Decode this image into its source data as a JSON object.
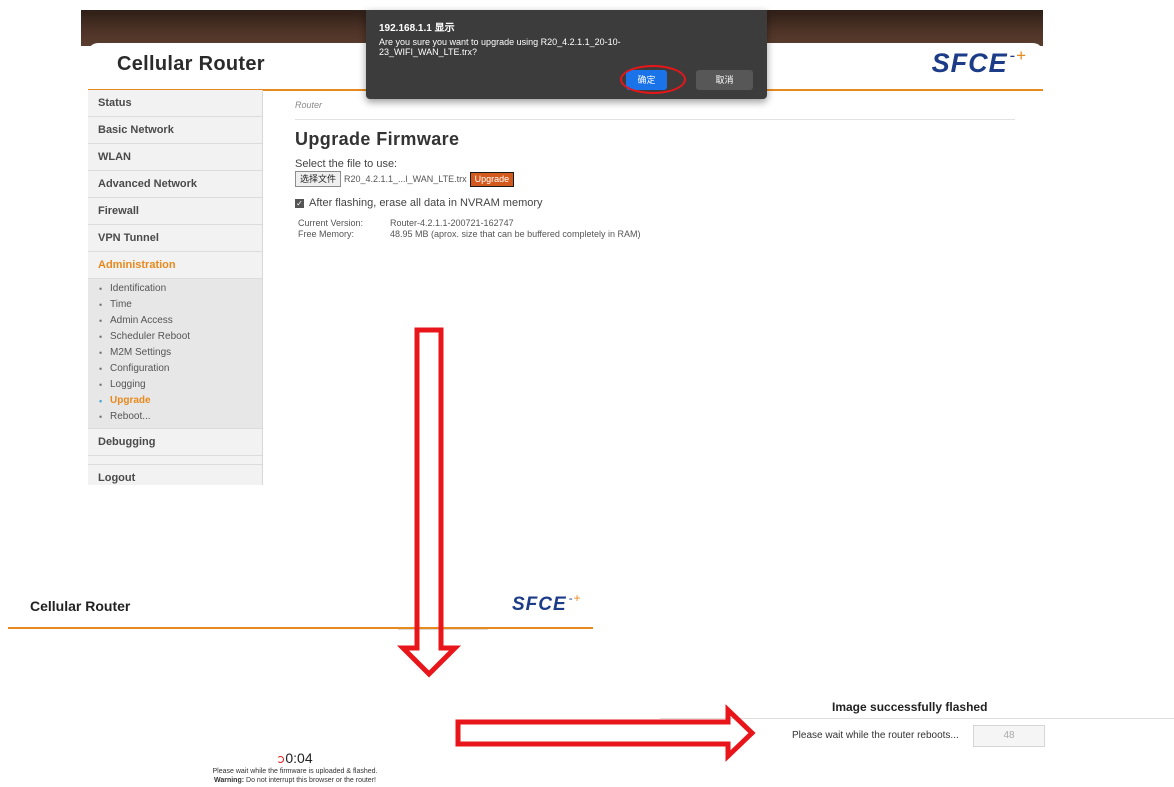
{
  "router": {
    "app_title": "Cellular Router",
    "logo_text": "SFCE",
    "sidebar": {
      "items_top": [
        "Status",
        "Basic Network",
        "WLAN",
        "Advanced Network",
        "Firewall",
        "VPN Tunnel"
      ],
      "active_section": "Administration",
      "sub_items": [
        "Identification",
        "Time",
        "Admin Access",
        "Scheduler Reboot",
        "M2M Settings",
        "Configuration",
        "Logging",
        "Upgrade",
        "Reboot..."
      ],
      "active_sub": "Upgrade",
      "items_bottom": [
        "Debugging",
        "Logout"
      ]
    },
    "breadcrumb": "Router",
    "page_title": "Upgrade Firmware",
    "select_label": "Select the file to use:",
    "file_button": "选择文件",
    "file_name": "R20_4.2.1.1_...l_WAN_LTE.trx",
    "upgrade_button": "Upgrade",
    "erase_label": "After flashing, erase all data in NVRAM memory",
    "erase_checked": true,
    "current_version_label": "Current Version:",
    "current_version": "Router-4.2.1.1-200721-162747",
    "free_memory_label": "Free Memory:",
    "free_memory": "48.95 MB  (aprox. size that can be buffered completely in RAM)"
  },
  "dialog": {
    "title": "192.168.1.1 显示",
    "message": "Are you sure you want to upgrade using R20_4.2.1.1_20-10-23_WIFI_WAN_LTE.trx?",
    "ok_label": "确定",
    "cancel_label": "取消"
  },
  "uploading": {
    "app_title": "Cellular Router",
    "logo_text": "SFCE",
    "timer": "0:04",
    "wait_text": "Please wait while the firmware is uploaded & flashed.",
    "warning_label": "Warning:",
    "warning_text": "Do not interrupt this browser or the router!"
  },
  "flashed": {
    "title": "Image successfully flashed",
    "message": "Please wait while the router reboots...",
    "countdown": "48"
  },
  "colors": {
    "accent_orange": "#e8891d",
    "brand_blue": "#1c3c88",
    "arrow_red": "#e8161a",
    "dialog_bg": "#3c3c3c",
    "ok_blue": "#1a73e8"
  }
}
